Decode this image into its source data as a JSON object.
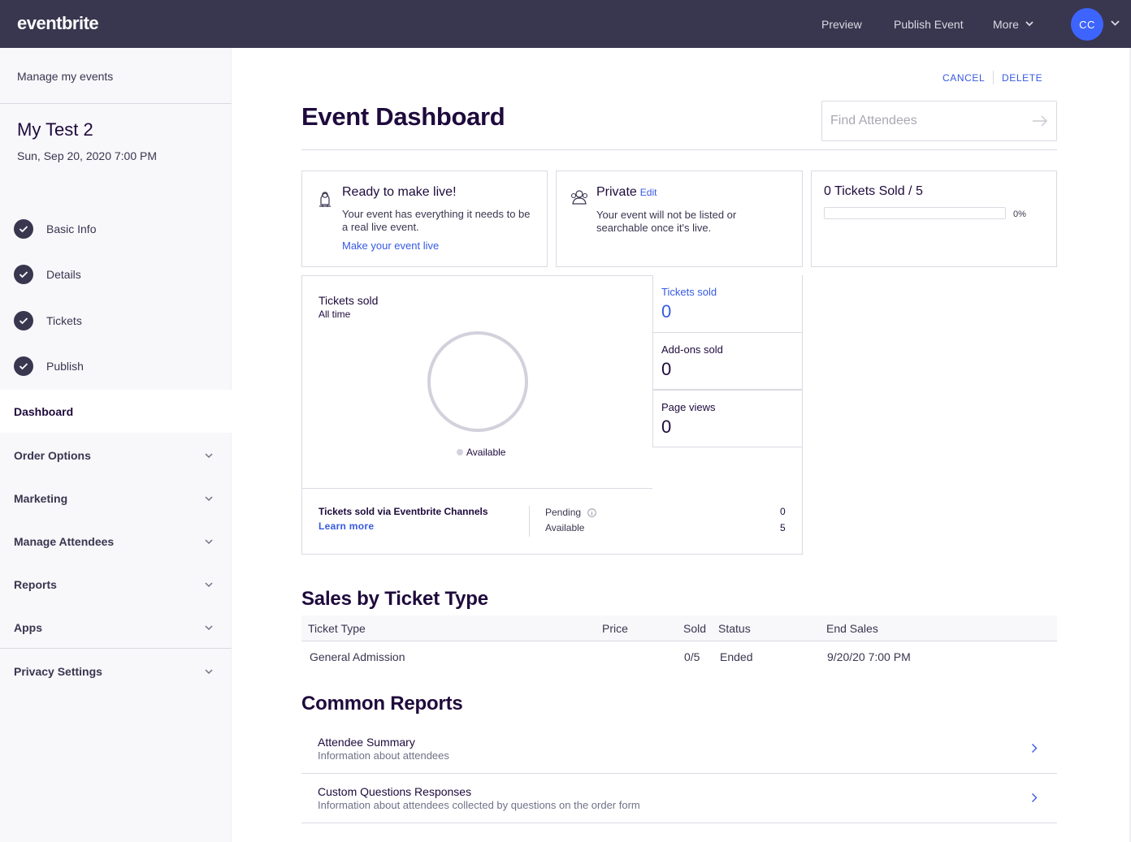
{
  "header": {
    "logo": "eventbrite",
    "preview": "Preview",
    "publish": "Publish Event",
    "more": "More",
    "avatar_initials": "CC"
  },
  "sidebar": {
    "manage_link": "Manage my events",
    "event_title": "My Test 2",
    "event_date": "Sun, Sep 20, 2020 7:00 PM",
    "steps": [
      {
        "label": "Basic Info"
      },
      {
        "label": "Details"
      },
      {
        "label": "Tickets"
      },
      {
        "label": "Publish"
      }
    ],
    "active_item": "Dashboard",
    "menus": [
      {
        "label": "Order Options"
      },
      {
        "label": "Marketing"
      },
      {
        "label": "Manage Attendees"
      },
      {
        "label": "Reports"
      },
      {
        "label": "Apps"
      },
      {
        "label": "Privacy Settings"
      }
    ]
  },
  "actions": {
    "cancel": "CANCEL",
    "delete": "DELETE"
  },
  "page_title": "Event Dashboard",
  "search": {
    "placeholder": "Find Attendees",
    "value": ""
  },
  "cards": {
    "live": {
      "title": "Ready to make live!",
      "text": "Your event has everything it needs to be a real live event.",
      "link": "Make your event live"
    },
    "privacy": {
      "title": "Private",
      "edit": "Edit",
      "text": "Your event will not be listed or searchable once it's live."
    },
    "sold": {
      "title": "0 Tickets Sold / 5",
      "percent_label": "0%",
      "progress_fraction": 0.0
    }
  },
  "tickets_chart": {
    "title": "Tickets sold",
    "subtitle": "All time",
    "legend": "Available",
    "ring_color": "#d2d1dc"
  },
  "stats": [
    {
      "label": "Tickets sold",
      "value": "0",
      "highlight": true
    },
    {
      "label": "Add-ons sold",
      "value": "0",
      "highlight": false
    },
    {
      "label": "Page views",
      "value": "0",
      "highlight": false
    }
  ],
  "channels": {
    "title": "Tickets sold via Eventbrite Channels",
    "learn_more": "Learn more",
    "pending_label": "Pending",
    "pending_value": "0",
    "available_label": "Available",
    "available_value": "5"
  },
  "sales": {
    "title": "Sales by Ticket Type",
    "columns": [
      "Ticket Type",
      "Price",
      "Sold",
      "Status",
      "End Sales"
    ],
    "rows": [
      {
        "ticket_type": "General Admission",
        "price": "",
        "sold": "0/5",
        "status": "Ended",
        "end_sales": "9/20/20 7:00 PM"
      }
    ]
  },
  "reports": {
    "title": "Common Reports",
    "items": [
      {
        "name": "Attendee Summary",
        "description": "Information about attendees"
      },
      {
        "name": "Custom Questions Responses",
        "description": "Information about attendees collected by questions on the order form"
      }
    ]
  },
  "colors": {
    "topbar": "#39364f",
    "link": "#3659e3",
    "avatar": "#3d64ff",
    "heading": "#1e0a3c"
  }
}
